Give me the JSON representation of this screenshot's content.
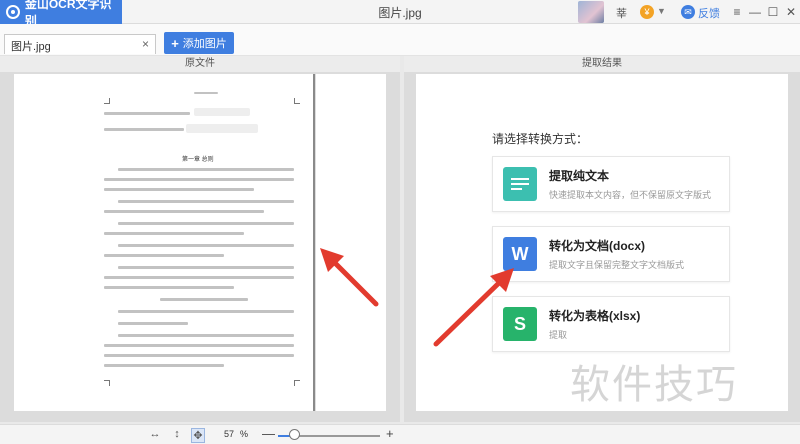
{
  "app": {
    "brand": "金山OCR文字识别",
    "window_title": "图片.jpg",
    "user_label": "莘",
    "vip_coin": "¥",
    "feedback_label": "反馈",
    "window_controls": [
      "≡",
      "—",
      "☐",
      "✕"
    ]
  },
  "tabs": {
    "file_tab": "图片.jpg",
    "close_symbol": "×",
    "add_image": "添加图片",
    "add_plus": "+"
  },
  "panels": {
    "left_header": "原文件",
    "right_header": "提取结果"
  },
  "document": {
    "section_title": "第一章 总则"
  },
  "result": {
    "choose_label": "请选择转换方式：",
    "options": [
      {
        "title": "提取纯文本",
        "desc": "快速提取本文内容，但不保留原文字版式",
        "icon": "text-lines-icon",
        "color": "#3cbfb0"
      },
      {
        "title": "转化为文档(docx)",
        "desc": "提取文字且保留完整文字文档版式",
        "icon": "word-w-icon",
        "color": "#3f7ee0"
      },
      {
        "title": "转化为表格(xlsx)",
        "desc": "提取",
        "icon": "sheet-s-icon",
        "color": "#27b36b"
      }
    ]
  },
  "watermark": "软件技巧",
  "bottom": {
    "zoom_value": "57",
    "zoom_unit": "%",
    "zoom_minus": "—",
    "zoom_plus": "+",
    "zoom_level": 0.16
  }
}
